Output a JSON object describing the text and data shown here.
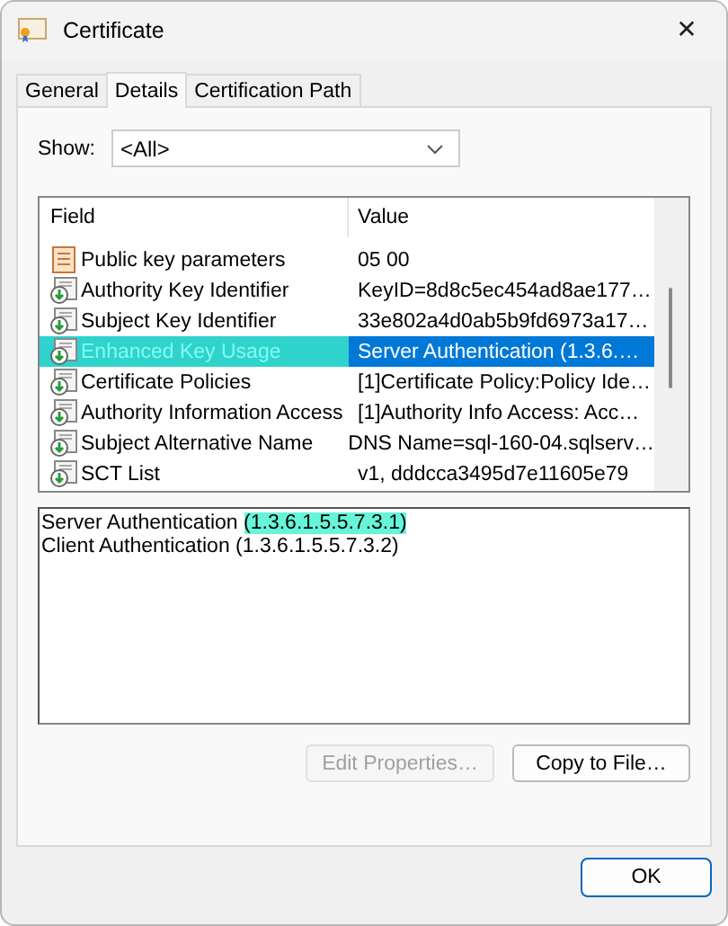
{
  "window": {
    "title": "Certificate",
    "close": "✕"
  },
  "tabs": [
    {
      "label": "General",
      "selected": false
    },
    {
      "label": "Details",
      "selected": true
    },
    {
      "label": "Certification Path",
      "selected": false
    }
  ],
  "show": {
    "label": "Show:",
    "value": "<All>"
  },
  "table": {
    "columns": [
      "Field",
      "Value"
    ],
    "rows": [
      {
        "kind": "plain",
        "field": "Public key parameters",
        "value": "05 00",
        "selected": false,
        "highlighted": false
      },
      {
        "kind": "extension",
        "field": "Authority Key Identifier",
        "value": "KeyID=8d8c5ec454ad8ae177…",
        "selected": false,
        "highlighted": false
      },
      {
        "kind": "extension",
        "field": "Subject Key Identifier",
        "value": "33e802a4d0ab5b9fd6973a17…",
        "selected": false,
        "highlighted": false
      },
      {
        "kind": "extension",
        "field": "Enhanced Key Usage",
        "value": "Server Authentication (1.3.6.…",
        "selected": true,
        "highlighted": true
      },
      {
        "kind": "extension",
        "field": "Certificate Policies",
        "value": "[1]Certificate Policy:Policy Ide…",
        "selected": false,
        "highlighted": false
      },
      {
        "kind": "extension",
        "field": "Authority Information Access",
        "value": "[1]Authority Info Access: Acc…",
        "selected": false,
        "highlighted": false
      },
      {
        "kind": "extension",
        "field": "Subject Alternative Name",
        "value": "DNS Name=sql-160-04.sqlserv…",
        "selected": false,
        "highlighted": false
      },
      {
        "kind": "extension",
        "field": "SCT List",
        "value": "v1, dddcca3495d7e11605e79",
        "selected": false,
        "highlighted": false
      }
    ]
  },
  "details": [
    {
      "text": "Server Authentication",
      "highlight": "(1.3.6.1.5.5.7.3.1)"
    },
    {
      "text": "Client Authentication (1.3.6.1.5.5.7.3.2)"
    }
  ],
  "buttons": [
    {
      "label": "Edit Properties…",
      "disabled": true
    },
    {
      "label": "Copy to File…",
      "disabled": false
    }
  ],
  "ok": "OK"
}
